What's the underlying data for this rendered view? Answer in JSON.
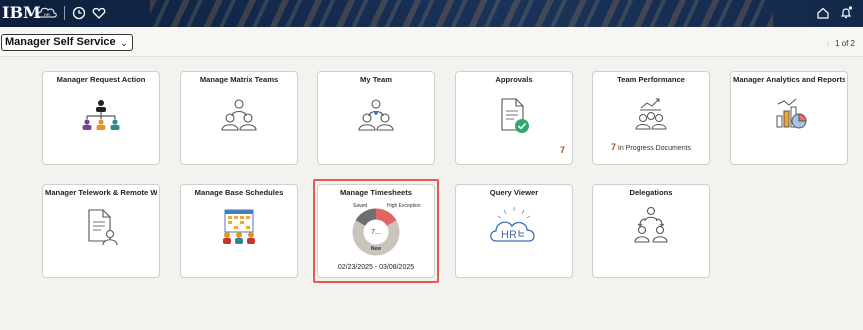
{
  "header": {
    "brand": "IBM",
    "icons": [
      "ibm-hr-logo-icon",
      "clock-icon",
      "heart-icon",
      "home-icon",
      "notifications-icon"
    ]
  },
  "dashboard": {
    "selector_label": "Manager Self Service",
    "pager": "1 of 2"
  },
  "tiles": [
    {
      "title": "Manager Request Action",
      "icon": "org-chart-icon"
    },
    {
      "title": "Manage Matrix Teams",
      "icon": "team-icon"
    },
    {
      "title": "My Team",
      "icon": "my-team-icon"
    },
    {
      "title": "Approvals",
      "icon": "approval-document-icon",
      "count": "7"
    },
    {
      "title": "Team Performance",
      "icon": "team-performance-icon",
      "count": "7",
      "status": "In Progress Documents"
    },
    {
      "title": "Manager Analytics and Reports",
      "icon": "analytics-chart-icon"
    },
    {
      "title": "Manager Telework & Remote W...",
      "icon": "telework-document-icon"
    },
    {
      "title": "Manage Base Schedules",
      "icon": "schedule-meeting-icon"
    },
    {
      "title": "Manage Timesheets",
      "icon": "timesheet-donut-icon",
      "saved_label": "Saved",
      "high_label": "High Exception",
      "center": "7...",
      "new_label": "New",
      "date_range": "02/23/2025 - 03/08/2025"
    },
    {
      "title": "Query Viewer",
      "icon": "hr-cloud-icon"
    },
    {
      "title": "Delegations",
      "icon": "delegation-icon"
    }
  ],
  "colors": {
    "topbar": "#13294b",
    "accent_count": "#b1521a",
    "highlight_border": "#e45a5a",
    "donut_saved": "#6f6f6f",
    "donut_high": "#e06666",
    "donut_new": "#c9c4bc"
  }
}
